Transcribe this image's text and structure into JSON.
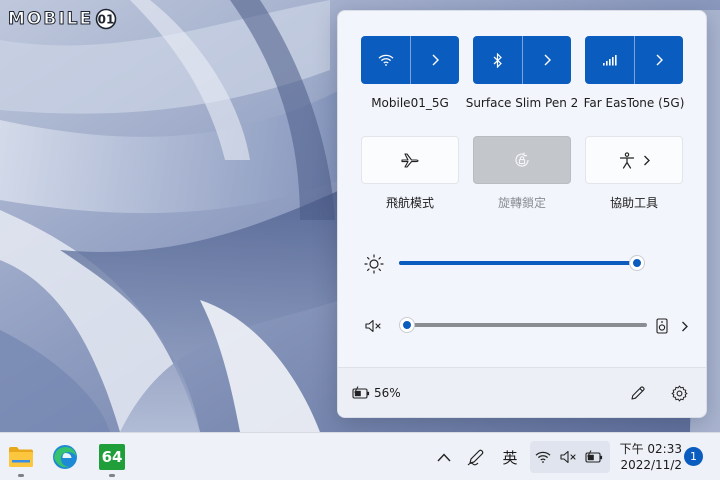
{
  "watermark": {
    "text": "MOBILE",
    "badge_icon": "mobile01-badge-icon"
  },
  "quick_settings": {
    "tiles": [
      {
        "label": "Mobile01_5G",
        "icon": "wifi-icon",
        "state": "on",
        "has_chevron": true
      },
      {
        "label": "Surface Slim Pen 2",
        "icon": "bluetooth-icon",
        "state": "on",
        "has_chevron": true
      },
      {
        "label": "Far EasTone (5G)",
        "icon": "cellular-icon",
        "state": "on",
        "has_chevron": true
      },
      {
        "label": "飛航模式",
        "icon": "airplane-icon",
        "state": "off"
      },
      {
        "label": "旋轉鎖定",
        "icon": "rotation-lock-icon",
        "state": "disabled"
      },
      {
        "label": "協助工具",
        "icon": "accessibility-icon",
        "state": "off",
        "has_chevron": true
      }
    ],
    "brightness": {
      "icon": "brightness-icon",
      "value_percent": 100
    },
    "volume": {
      "icon": "volume-muted-icon",
      "value_percent": 0,
      "device_icon": "speaker-device-icon"
    },
    "battery": {
      "icon": "battery-charging-icon",
      "text": "56%"
    },
    "footer_actions": [
      "edit-pencil-icon",
      "settings-gear-icon"
    ]
  },
  "taskbar": {
    "apps": [
      "file-explorer-icon",
      "edge-browser-icon",
      "aida64-icon"
    ],
    "tray": {
      "overflow_icon": "chevron-up-icon",
      "pen_icon": "pen-menu-icon",
      "ime": "英",
      "status_icons": [
        "wifi-icon",
        "volume-muted-icon",
        "battery-charging-icon"
      ]
    },
    "clock": {
      "time": "下午 02:33",
      "date": "2022/11/2"
    },
    "notification_count": "1",
    "app3_label": "64"
  },
  "colors": {
    "accent": "#0b5cbf",
    "panel_bg": "#f2f5fb",
    "taskbar_bg": "#eef1f7"
  }
}
